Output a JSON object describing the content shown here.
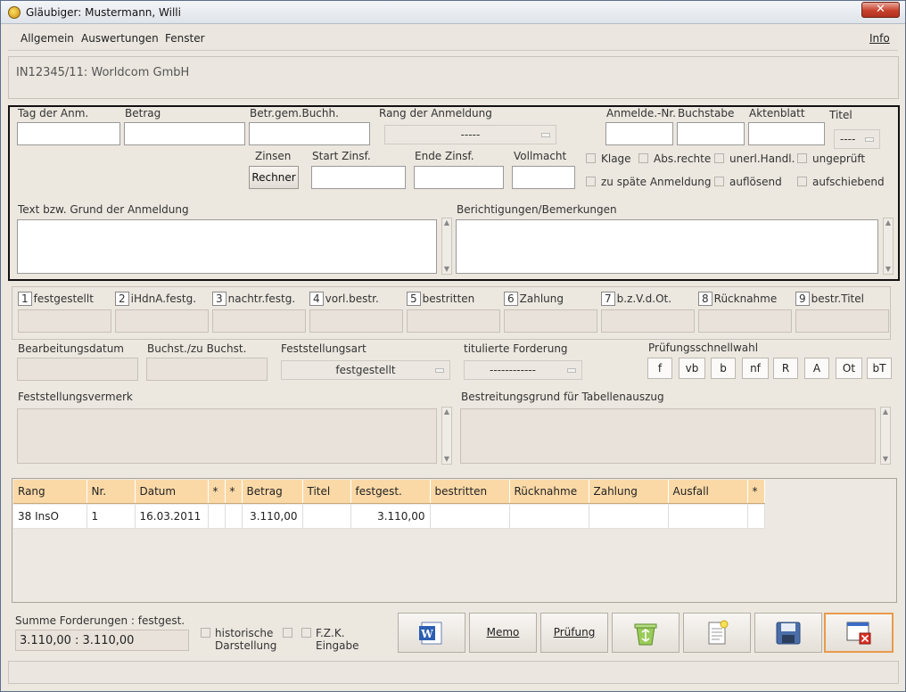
{
  "window": {
    "title": "Gläubiger: Mustermann, Willi",
    "close_label": "✕"
  },
  "menu": {
    "items": [
      "Allgemein",
      "Auswertungen",
      "Fenster"
    ],
    "info": "Info"
  },
  "case": {
    "label": "IN12345/11: Worldcom GmbH"
  },
  "form": {
    "tag_der_anm": "Tag der Anm.",
    "betrag": "Betrag",
    "betr_gem_buchh": "Betr.gem.Buchh.",
    "rang_der_anmeldung": "Rang der Anmeldung",
    "rang_value": "-----",
    "anmelde_nr": "Anmelde.-Nr.",
    "buchstabe": "Buchstabe",
    "aktenblatt": "Aktenblatt",
    "titel": "Titel",
    "titel_value": "----",
    "zinsen": "Zinsen",
    "rechner": "Rechner",
    "start_zinsf": "Start Zinsf.",
    "ende_zinsf": "Ende Zinsf.",
    "vollmacht": "Vollmacht",
    "checks": [
      "Klage",
      "Abs.rechte",
      "unerl.Handl.",
      "ungeprüft",
      "zu späte Anmeldung",
      "auflösend",
      "aufschiebend"
    ],
    "text_grund": "Text bzw. Grund der Anmeldung",
    "berichtigungen": "Berichtigungen/Bemerkungen"
  },
  "status_cols": [
    {
      "key": "1",
      "label": "festgestellt"
    },
    {
      "key": "2",
      "label": "iHdnA.festg."
    },
    {
      "key": "3",
      "label": "nachtr.festg."
    },
    {
      "key": "4",
      "label": "vorl.bestr."
    },
    {
      "key": "5",
      "label": "bestritten"
    },
    {
      "key": "6",
      "label": "Zahlung"
    },
    {
      "key": "7",
      "label": "b.z.V.d.Ot."
    },
    {
      "key": "8",
      "label": "Rücknahme"
    },
    {
      "key": "9",
      "label": "bestr.Titel"
    }
  ],
  "details": {
    "bearbeitungsdatum": "Bearbeitungsdatum",
    "buchst_zu_buchst": "Buchst./zu Buchst.",
    "feststellungsart": "Feststellungsart",
    "feststellungsart_value": "festgestellt",
    "titulierte_forderung": "titulierte Forderung",
    "titulierte_value": "------------",
    "pruefungsschnellwahl": "Prüfungsschnellwahl",
    "quick": [
      "f",
      "vb",
      "b",
      "nf",
      "R",
      "A",
      "Ot",
      "bT"
    ],
    "feststellungsvermerk": "Feststellungsvermerk",
    "bestreitungsgrund": "Bestreitungsgrund für Tabellenauszug"
  },
  "table": {
    "headers": [
      "Rang",
      "Nr.",
      "Datum",
      "*",
      "*",
      "Betrag",
      "Titel",
      "festgest.",
      "bestritten",
      "Rücknahme",
      "Zahlung",
      "Ausfall",
      "*"
    ],
    "rows": [
      [
        "38 InsO",
        "1",
        "16.03.2011",
        "",
        "",
        "3.110,00",
        "",
        "3.110,00",
        "",
        "",
        "",
        "",
        ""
      ]
    ]
  },
  "summary": {
    "label": "Summe Forderungen : festgest.",
    "value": "3.110,00 : 3.110,00",
    "historische": "historische",
    "darstellung": "Darstellung",
    "fzk": "F.Z.K.",
    "eingabe": "Eingabe"
  },
  "buttons": {
    "memo": "Memo",
    "pruefung": "Prüfung"
  }
}
